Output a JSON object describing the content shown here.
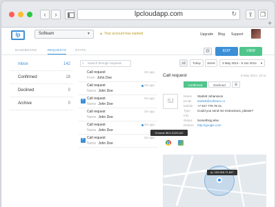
{
  "browser": {
    "url": "lpcloudapp.com",
    "back_icon": "chevron-left-icon",
    "forward_icon": "chevron-right-icon"
  },
  "header": {
    "logo_text": "lp",
    "account": "Softeam",
    "trial_warning": "Your account has expired",
    "links": [
      "Upgrade",
      "Blog",
      "Support"
    ]
  },
  "tabs": [
    "DASHBOARD",
    "REQUESTS",
    "STATS"
  ],
  "actions": {
    "edit": "EDIT",
    "view": "VIEW"
  },
  "sidebar": {
    "items": [
      {
        "label": "Inbox",
        "count": "142"
      },
      {
        "label": "Confirmed",
        "count": "18"
      },
      {
        "label": "Declined",
        "count": "0"
      },
      {
        "label": "Archive",
        "count": "0"
      }
    ]
  },
  "filters": {
    "search_placeholder": "Search through requests",
    "all": "All",
    "today": "Today",
    "week": "Week",
    "date_range": "3 May 2014 - 9 Jun 2014"
  },
  "requests": [
    {
      "title": "Call request",
      "from_label": "From",
      "from": "John Doe",
      "time": "2m ago",
      "checked": false,
      "unread": false
    },
    {
      "title": "Call request",
      "from_label": "Name",
      "from": "John Doe",
      "time": "2m ago",
      "checked": false,
      "unread": true
    },
    {
      "title": "Call request",
      "from_label": "Name",
      "from": "John Doe",
      "time": "2m ago",
      "checked": true,
      "unread": false
    },
    {
      "title": "Call request",
      "from_label": "Name",
      "from": "John Doe",
      "time": "2m ago",
      "checked": false,
      "unread": false
    },
    {
      "title": "Call request",
      "from_label": "Name",
      "from": "John Doe",
      "time": "2m ago",
      "checked": false,
      "unread": true
    },
    {
      "title": "Call request",
      "from_label": "Name",
      "from": "John Doe",
      "time": "2m ago",
      "checked": true,
      "unread": false
    }
  ],
  "detail": {
    "title": "Call request",
    "time": "8 May 2014, 22:11",
    "status": {
      "confirmed": "Confirmed",
      "declined": "Declined"
    },
    "initials": "SJ",
    "fields": [
      {
        "label": "Name",
        "value": "Starlett Johansson",
        "link": false
      },
      {
        "label": "Email",
        "value": "starlett@softeam.co",
        "link": true
      },
      {
        "label": "Mobile",
        "value": "+7 917 778 78 21",
        "link": false
      },
      {
        "label": "Type",
        "value": "Could you send me instructions, please?",
        "link": false
      },
      {
        "label": "Info",
        "value": "",
        "link": false
      },
      {
        "label": "Status",
        "value": "Something else",
        "link": false
      },
      {
        "label": "Referer",
        "value": "http://google.com",
        "link": true
      }
    ],
    "tooltip": "Chrome 38.0.2125.122",
    "ip_label": "ip: 132.916.71.847"
  },
  "colors": {
    "accent": "#3b8fd6",
    "success": "#4fc58c",
    "warning": "#b89a1e"
  }
}
